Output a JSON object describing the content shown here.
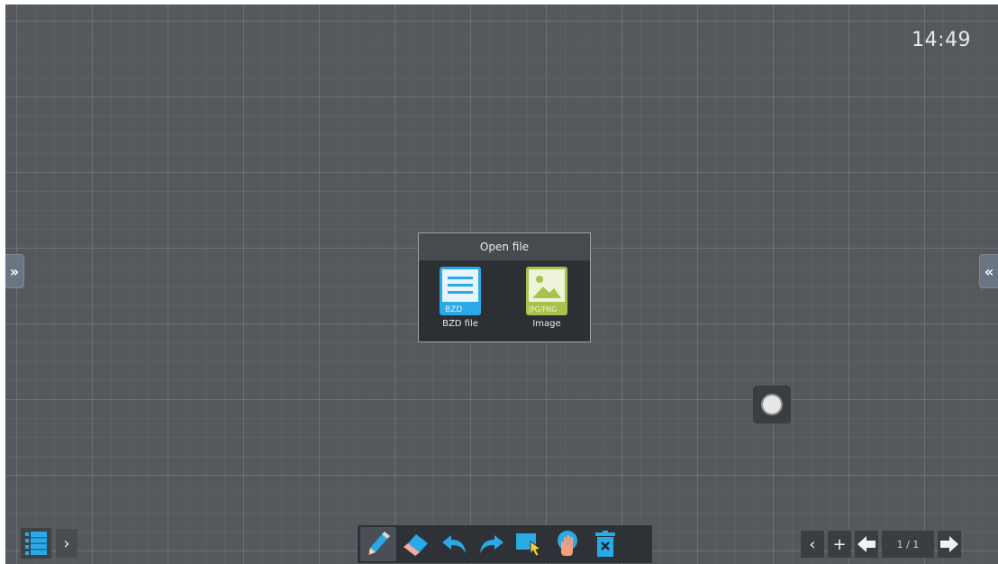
{
  "clock": "14:49",
  "side_tabs": {
    "left_glyph": "»",
    "right_glyph": "«"
  },
  "dialog": {
    "title": "Open file",
    "options": [
      {
        "label": "BZD file",
        "icon": "bzd-file-icon",
        "badge": "BZD",
        "color": "#29a9e6"
      },
      {
        "label": "Image",
        "icon": "image-file-icon",
        "badge": "JPG/PNG",
        "color": "#a9c24b"
      }
    ]
  },
  "bottom_left": {
    "menu_icon": "page-list-icon",
    "expand_glyph": "›"
  },
  "toolbar": {
    "tools": [
      "pen-icon",
      "eraser-icon",
      "undo-icon",
      "redo-icon",
      "select-icon",
      "hand-icon",
      "delete-icon"
    ],
    "active": "pen-icon"
  },
  "pager": {
    "prev_glyph": "‹",
    "add_glyph": "+",
    "page_text": "1 / 1"
  },
  "colors": {
    "board": "#55595d",
    "accent_blue": "#29a9e6"
  }
}
